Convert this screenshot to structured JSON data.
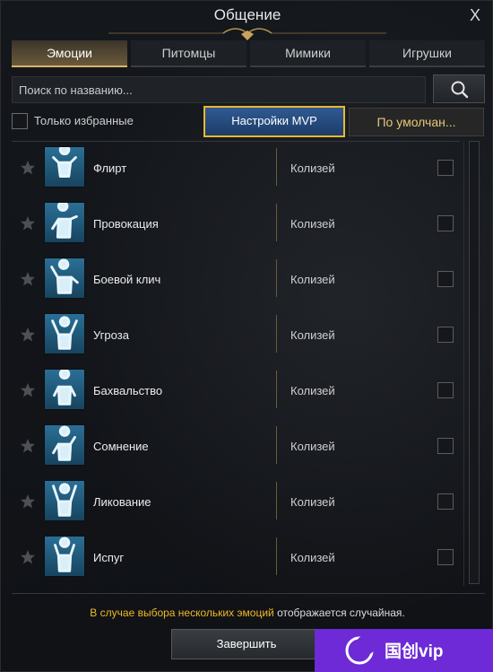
{
  "window": {
    "title": "Общение",
    "close_label": "X"
  },
  "tabs": [
    {
      "label": "Эмоции",
      "active": true
    },
    {
      "label": "Питомцы",
      "active": false
    },
    {
      "label": "Мимики",
      "active": false
    },
    {
      "label": "Игрушки",
      "active": false
    }
  ],
  "search": {
    "placeholder": "Поиск по названию...",
    "value": "",
    "icon": "search-icon"
  },
  "filters": {
    "favorites_label": "Только избранные",
    "favorites_checked": false,
    "mvp_button_label": "Настройки MVP",
    "default_button_label": "По умолчан..."
  },
  "emotes": [
    {
      "name": "Флирт",
      "location": "Колизей",
      "icon": "flirt-emote-icon",
      "selected": false
    },
    {
      "name": "Провокация",
      "location": "Колизей",
      "icon": "provocation-emote-icon",
      "selected": false
    },
    {
      "name": "Боевой клич",
      "location": "Колизей",
      "icon": "battle-cry-emote-icon",
      "selected": false
    },
    {
      "name": "Угроза",
      "location": "Колизей",
      "icon": "threat-emote-icon",
      "selected": false
    },
    {
      "name": "Бахвальство",
      "location": "Колизей",
      "icon": "boast-emote-icon",
      "selected": false
    },
    {
      "name": "Сомнение",
      "location": "Колизей",
      "icon": "doubt-emote-icon",
      "selected": false
    },
    {
      "name": "Ликование",
      "location": "Колизей",
      "icon": "jubilation-emote-icon",
      "selected": false
    },
    {
      "name": "Испуг",
      "location": "Колизей",
      "icon": "fright-emote-icon",
      "selected": false
    }
  ],
  "footer": {
    "note_highlight": "В случае выбора нескольких эмоций",
    "note_rest": " отображается случайная.",
    "finish_button_label": "Завершить"
  },
  "watermark": {
    "text": "国创vip"
  },
  "colors": {
    "accent_gold": "#e8b92e",
    "highlight_text": "#f0b824",
    "mvp_button_blue": "#2f5a93",
    "icon_blue": "#2a6f96"
  }
}
